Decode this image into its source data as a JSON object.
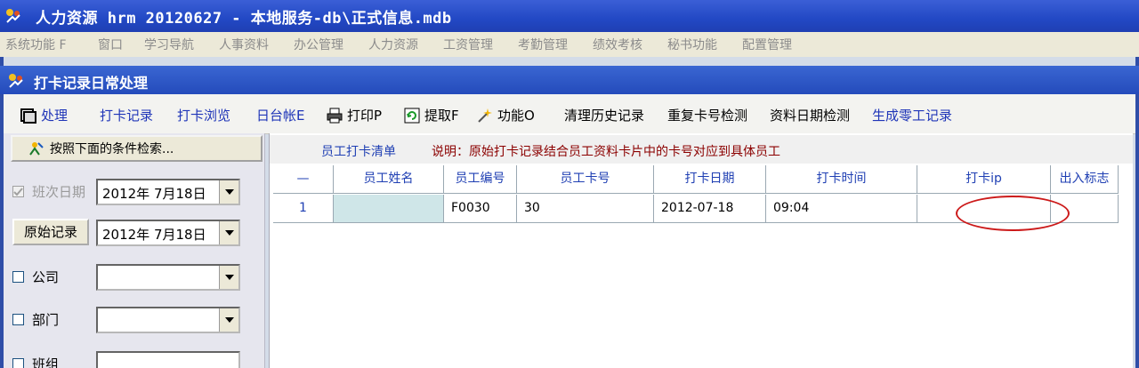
{
  "window": {
    "title": "人力资源 hrm 20120627 - 本地服务-db\\正式信息.mdb"
  },
  "menubar": {
    "items": [
      "系统功能 F",
      "窗口",
      "学习导航",
      "人事资料",
      "办公管理",
      "人力资源",
      "工资管理",
      "考勤管理",
      "绩效考核",
      "秘书功能",
      "配置管理"
    ]
  },
  "child": {
    "title": "打卡记录日常处理"
  },
  "toolbar": {
    "process": "处理",
    "clock_record": "打卡记录",
    "clock_browse": "打卡浏览",
    "daily_ledger": "日台帐E",
    "print": "打印P",
    "extract": "提取F",
    "function": "功能O",
    "clean_history": "清理历史记录",
    "dup_card_check": "重复卡号检测",
    "date_check": "资料日期检测",
    "gen_temp": "生成零工记录"
  },
  "filter": {
    "search_label": "按照下面的条件检索...",
    "shift_date_label": "班次日期",
    "shift_date_value": "2012年  7月18日",
    "raw_record_button": "原始记录",
    "raw_record_date": "2012年  7月18日",
    "company_label": "公司",
    "department_label": "部门",
    "group_label": "班组"
  },
  "list": {
    "title": "员工打卡清单",
    "description": "说明：原始打卡记录结合员工资料卡片中的卡号对应到具体员工",
    "columns": [
      "—",
      "员工姓名",
      "员工编号",
      "员工卡号",
      "打卡日期",
      "打卡时间",
      "打卡ip",
      "出入标志"
    ],
    "rows": [
      [
        "1",
        "",
        "F0030",
        "30",
        "2012-07-18",
        "09:04",
        "",
        ""
      ]
    ]
  },
  "colors": {
    "title_bar": "#2248c4",
    "menu_bg": "#ece9d8",
    "grid_header": "#cfe9df",
    "grid_row": "#ccf5e0",
    "annotation": "#cc1a1a"
  }
}
